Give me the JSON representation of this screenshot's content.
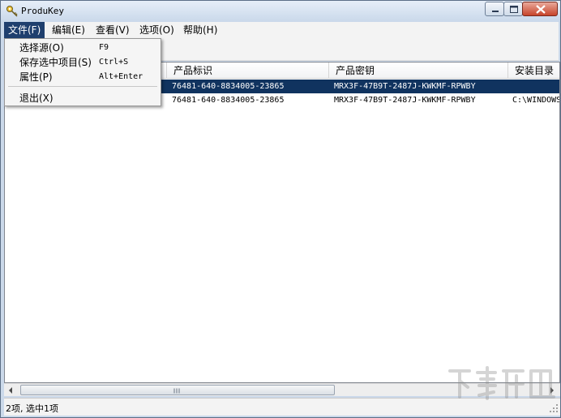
{
  "window": {
    "title": "ProduKey"
  },
  "menubar": {
    "items": [
      {
        "label": "文件(F)"
      },
      {
        "label": "编辑(E)"
      },
      {
        "label": "查看(V)"
      },
      {
        "label": "选项(O)"
      },
      {
        "label": "帮助(H)"
      }
    ]
  },
  "file_menu": {
    "items": [
      {
        "label": "选择源(O)",
        "shortcut": "F9"
      },
      {
        "label": "保存选中项目(S)",
        "shortcut": "Ctrl+S"
      },
      {
        "label": "属性(P)",
        "shortcut": "Alt+Enter"
      },
      {
        "label": "退出(X)",
        "shortcut": ""
      }
    ]
  },
  "list": {
    "columns": [
      "",
      "产品标识",
      "产品密钥",
      "安装目录"
    ],
    "rows": [
      {
        "product_id": "76481-640-8834005-23865",
        "product_key": "MRX3F-47B9T-2487J-KWKMF-RPWBY",
        "install_dir": "",
        "selected": true
      },
      {
        "product_id": "76481-640-8834005-23865",
        "product_key": "MRX3F-47B9T-2487J-KWKMF-RPWBY",
        "install_dir": "C:\\WINDOWS",
        "selected": false
      }
    ]
  },
  "status": {
    "text": "2项, 选中1项"
  },
  "colors": {
    "selection": "#10335f",
    "menu_highlight": "#1f3f6e",
    "chrome": "#cbd9ea"
  }
}
